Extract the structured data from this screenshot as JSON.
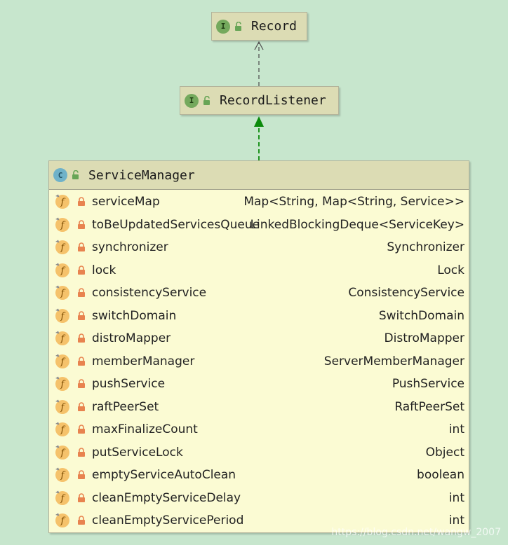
{
  "record": {
    "badge": "I",
    "name": "Record"
  },
  "record_listener": {
    "badge": "I",
    "name": "RecordListener"
  },
  "service_manager": {
    "badge": "C",
    "name": "ServiceManager",
    "fields": [
      {
        "name": "serviceMap",
        "type": "Map<String, Map<String, Service>>"
      },
      {
        "name": "toBeUpdatedServicesQueue",
        "type": "LinkedBlockingDeque<ServiceKey>"
      },
      {
        "name": "synchronizer",
        "type": "Synchronizer"
      },
      {
        "name": "lock",
        "type": "Lock"
      },
      {
        "name": "consistencyService",
        "type": "ConsistencyService"
      },
      {
        "name": "switchDomain",
        "type": "SwitchDomain"
      },
      {
        "name": "distroMapper",
        "type": "DistroMapper"
      },
      {
        "name": "memberManager",
        "type": "ServerMemberManager"
      },
      {
        "name": "pushService",
        "type": "PushService"
      },
      {
        "name": "raftPeerSet",
        "type": "RaftPeerSet"
      },
      {
        "name": "maxFinalizeCount",
        "type": "int"
      },
      {
        "name": "putServiceLock",
        "type": "Object"
      },
      {
        "name": "emptyServiceAutoClean",
        "type": "boolean"
      },
      {
        "name": "cleanEmptyServiceDelay",
        "type": "int"
      },
      {
        "name": "cleanEmptyServicePeriod",
        "type": "int"
      }
    ]
  },
  "colors": {
    "background": "#c7e6cd",
    "header_fill": "#dcdcb4",
    "body_fill": "#fbfbd3",
    "implements_arrow": "#0b8a0b",
    "extends_arrow": "#555555",
    "field_icon": "#f5c26b",
    "lock_icon": "#e8834f"
  },
  "icons": {
    "interface_badge": "interface-badge-icon",
    "class_badge": "class-badge-icon",
    "visibility": "unlock-icon",
    "field": "field-icon",
    "private": "lock-icon"
  },
  "watermark": "https://blog.csdn.net/wangw_2007"
}
